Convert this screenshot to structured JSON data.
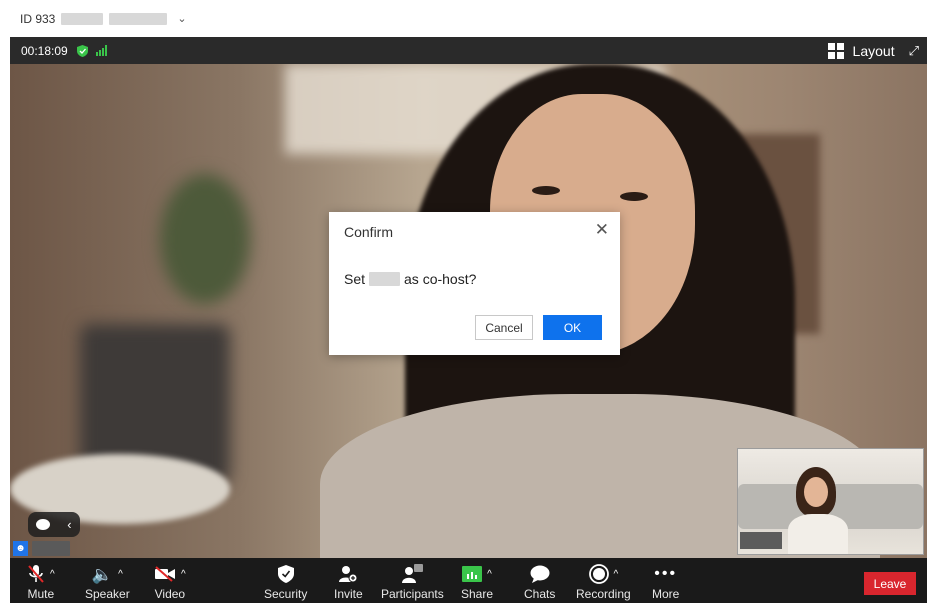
{
  "titlebar": {
    "meeting_id": "ID 933"
  },
  "topbar": {
    "timer": "00:18:09",
    "layout_label": "Layout"
  },
  "dialog": {
    "title": "Confirm",
    "message_prefix": "Set",
    "message_suffix": "as co-host?",
    "cancel_label": "Cancel",
    "ok_label": "OK"
  },
  "toolbar": {
    "items": [
      {
        "label": "Mute"
      },
      {
        "label": "Speaker"
      },
      {
        "label": "Video"
      },
      {
        "label": "Security"
      },
      {
        "label": "Invite"
      },
      {
        "label": "Participants"
      },
      {
        "label": "Share"
      },
      {
        "label": "Chats"
      },
      {
        "label": "Recording"
      },
      {
        "label": "More"
      }
    ],
    "leave_label": "Leave"
  },
  "colors": {
    "accent": "#0e72ed",
    "leave": "#d9262e",
    "secure": "#3ac54a"
  }
}
